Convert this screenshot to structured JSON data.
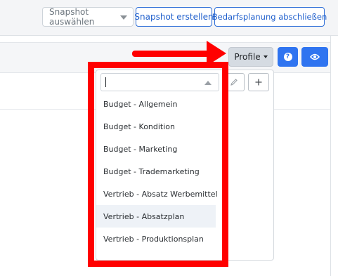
{
  "topbar": {
    "snapshot_select_placeholder": "Snapshot auswählen",
    "create_snapshot_label": "Snapshot erstellen",
    "finish_planning_label": "Bedarfsplanung abschließen"
  },
  "toolbar": {
    "profile_label": "Profile",
    "help_glyph": "?"
  },
  "profile_dropdown": {
    "search_value": "",
    "items": [
      {
        "label": "Budget - Allgemein"
      },
      {
        "label": "Budget - Kondition"
      },
      {
        "label": "Budget - Marketing"
      },
      {
        "label": "Budget - Trademarketing"
      },
      {
        "label": "Vertrieb - Absatz Werbemittel"
      },
      {
        "label": "Vertrieb - Absatzplan",
        "highlighted": true
      },
      {
        "label": "Vertrieb - Produktionsplan"
      }
    ]
  },
  "colors": {
    "primary": "#2f74f0",
    "annotation_red": "#ff0000",
    "outline_blue": "#2f6fd8"
  },
  "icons": {
    "edit": "pencil-icon",
    "add": "plus-icon",
    "help": "question-circle-icon",
    "view": "eye-icon",
    "annotation": "red-arrow"
  }
}
